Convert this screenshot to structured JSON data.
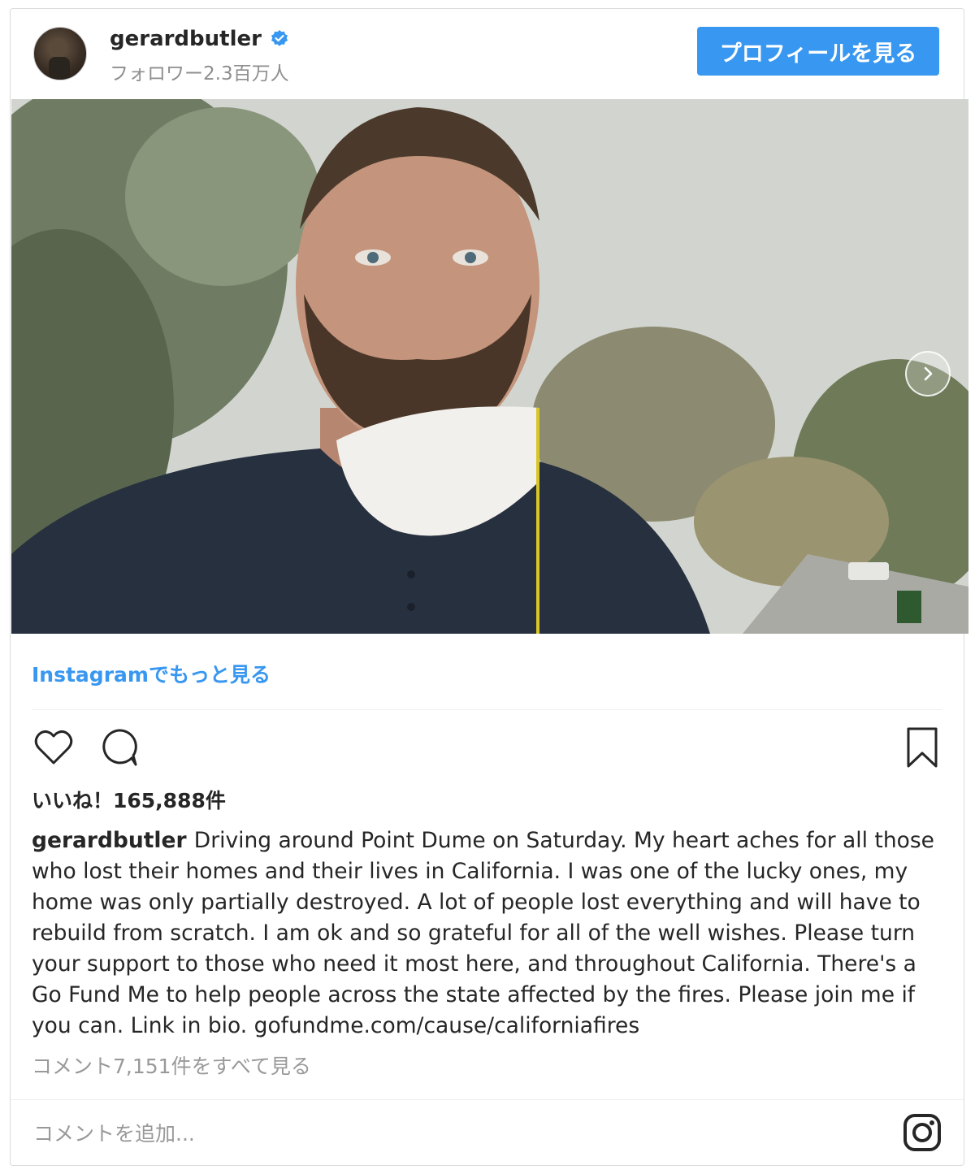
{
  "header": {
    "username": "gerardbutler",
    "followers": "フォロワー2.3百万人",
    "profile_button": "プロフィールを見る"
  },
  "more_link": "Instagramでもっと見る",
  "likes": "いいね！165,888件",
  "caption": {
    "username": "gerardbutler",
    "text": "Driving around Point Dume on Saturday. My heart aches for all those who lost their homes and their lives in California. I was one of the lucky ones, my home was only partially destroyed. A lot of people lost everything and will have to rebuild from scratch. I am ok and so grateful for all of the well wishes. Please turn your support to those who need it most here, and throughout California. There's a Go Fund Me to help people across the state affected by the fires. Please join me if you can. Link in bio. gofundme.com/cause/californiafires"
  },
  "view_comments": "コメント7,151件をすべて見る",
  "comment_placeholder": "コメントを追加...",
  "colors": {
    "accent": "#3897f0",
    "text": "#262626",
    "muted": "#8e8e8e"
  },
  "icons": [
    "verified-badge-icon",
    "chevron-right-icon",
    "heart-icon",
    "comment-icon",
    "bookmark-icon",
    "instagram-icon"
  ]
}
